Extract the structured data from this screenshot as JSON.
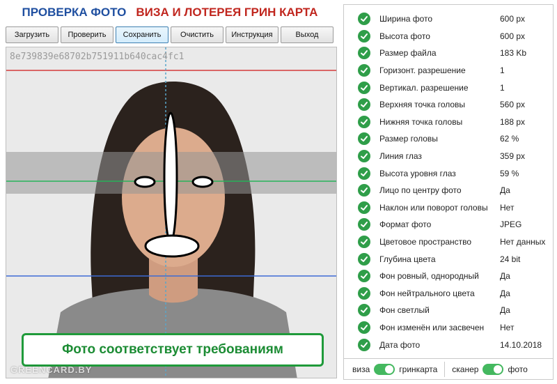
{
  "header": {
    "title_left": "ПРОВЕРКА ФОТО",
    "title_right": "ВИЗА И ЛОТЕРЕЯ ГРИН КАРТА"
  },
  "toolbar": {
    "buttons": [
      {
        "label": "Загрузить",
        "name": "load-button"
      },
      {
        "label": "Проверить",
        "name": "check-button"
      },
      {
        "label": "Сохранить",
        "name": "save-button"
      },
      {
        "label": "Очистить",
        "name": "clear-button"
      },
      {
        "label": "Инструкция",
        "name": "instruction-button"
      },
      {
        "label": "Выход",
        "name": "exit-button"
      }
    ]
  },
  "photo": {
    "hash": "8e739839e68702b751911b640cac4fc1",
    "verdict": "Фото соответствует требованиям",
    "watermark": "GREENCARD.BY"
  },
  "checks": [
    {
      "label": "Ширина фото",
      "value": "600 px"
    },
    {
      "label": "Высота фото",
      "value": "600 px"
    },
    {
      "label": "Размер файла",
      "value": "183 Kb"
    },
    {
      "label": "Горизонт. разрешение",
      "value": "1"
    },
    {
      "label": "Вертикал. разрешение",
      "value": "1"
    },
    {
      "label": "Верхняя точка головы",
      "value": "560 px"
    },
    {
      "label": "Нижняя точка головы",
      "value": "188 px"
    },
    {
      "label": "Размер головы",
      "value": "62 %"
    },
    {
      "label": "Линия глаз",
      "value": "359 px"
    },
    {
      "label": "Высота уровня глаз",
      "value": "59 %"
    },
    {
      "label": "Лицо по центру фото",
      "value": "Да"
    },
    {
      "label": "Наклон или поворот головы",
      "value": "Нет"
    },
    {
      "label": "Формат фото",
      "value": "JPEG"
    },
    {
      "label": "Цветовое пространство",
      "value": "Нет данных"
    },
    {
      "label": "Глубина цвета",
      "value": "24 bit"
    },
    {
      "label": "Фон ровный, однородный",
      "value": "Да"
    },
    {
      "label": "Фон нейтрального цвета",
      "value": "Да"
    },
    {
      "label": "Фон светлый",
      "value": "Да"
    },
    {
      "label": "Фон изменён или засвечен",
      "value": "Нет"
    },
    {
      "label": "Дата фото",
      "value": "14.10.2018"
    }
  ],
  "toggles": {
    "left_off": "виза",
    "left_on": "гринкарта",
    "right_off": "сканер",
    "right_on": "фото"
  },
  "colors": {
    "check_green": "#2f9e49",
    "title_blue": "#1f4fa0",
    "title_red": "#c0261e",
    "verdict_green": "#1c8c34"
  }
}
